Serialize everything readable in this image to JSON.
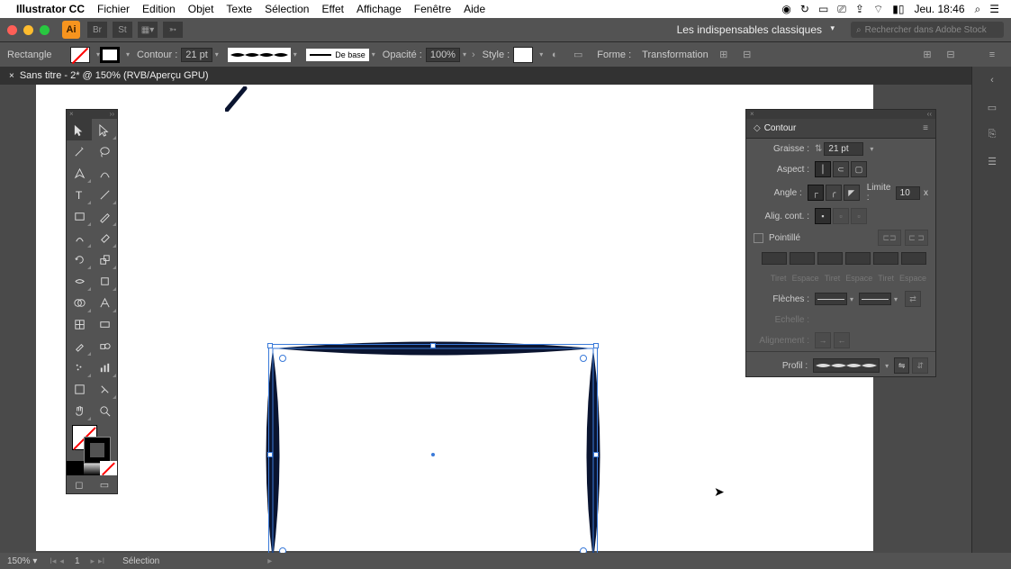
{
  "menubar": {
    "app_name": "Illustrator CC",
    "items": [
      "Fichier",
      "Edition",
      "Objet",
      "Texte",
      "Sélection",
      "Effet",
      "Affichage",
      "Fenêtre",
      "Aide"
    ],
    "clock": "Jeu. 18:46"
  },
  "topbar": {
    "app_badge": "Ai",
    "preset": "Les indispensables classiques",
    "search_placeholder": "Rechercher dans Adobe Stock"
  },
  "options": {
    "shape": "Rectangle",
    "contour_label": "Contour :",
    "contour_value": "21 pt",
    "stroke_def": "De base",
    "opacity_label": "Opacité :",
    "opacity_value": "100%",
    "style_label": "Style :",
    "forme_label": "Forme :",
    "transformation_label": "Transformation"
  },
  "doc_tab": {
    "title": "Sans titre - 2* @ 150% (RVB/Aperçu GPU)"
  },
  "contour_panel": {
    "title": "Contour",
    "graisse_label": "Graisse :",
    "graisse_value": "21 pt",
    "aspect_label": "Aspect :",
    "angle_label": "Angle :",
    "limite_label": "Limite :",
    "limite_value": "10",
    "limite_unit": "x",
    "align_label": "Alig. cont. :",
    "pointille_label": "Pointillé",
    "dash_headers": [
      "Tiret",
      "Espace",
      "Tiret",
      "Espace",
      "Tiret",
      "Espace"
    ],
    "fleches_label": "Flèches :",
    "echelle_label": "Echelle :",
    "alignement_label": "Alignement :",
    "profil_label": "Profil :"
  },
  "status": {
    "zoom": "150%",
    "artboard": "1",
    "tool": "Sélection"
  }
}
